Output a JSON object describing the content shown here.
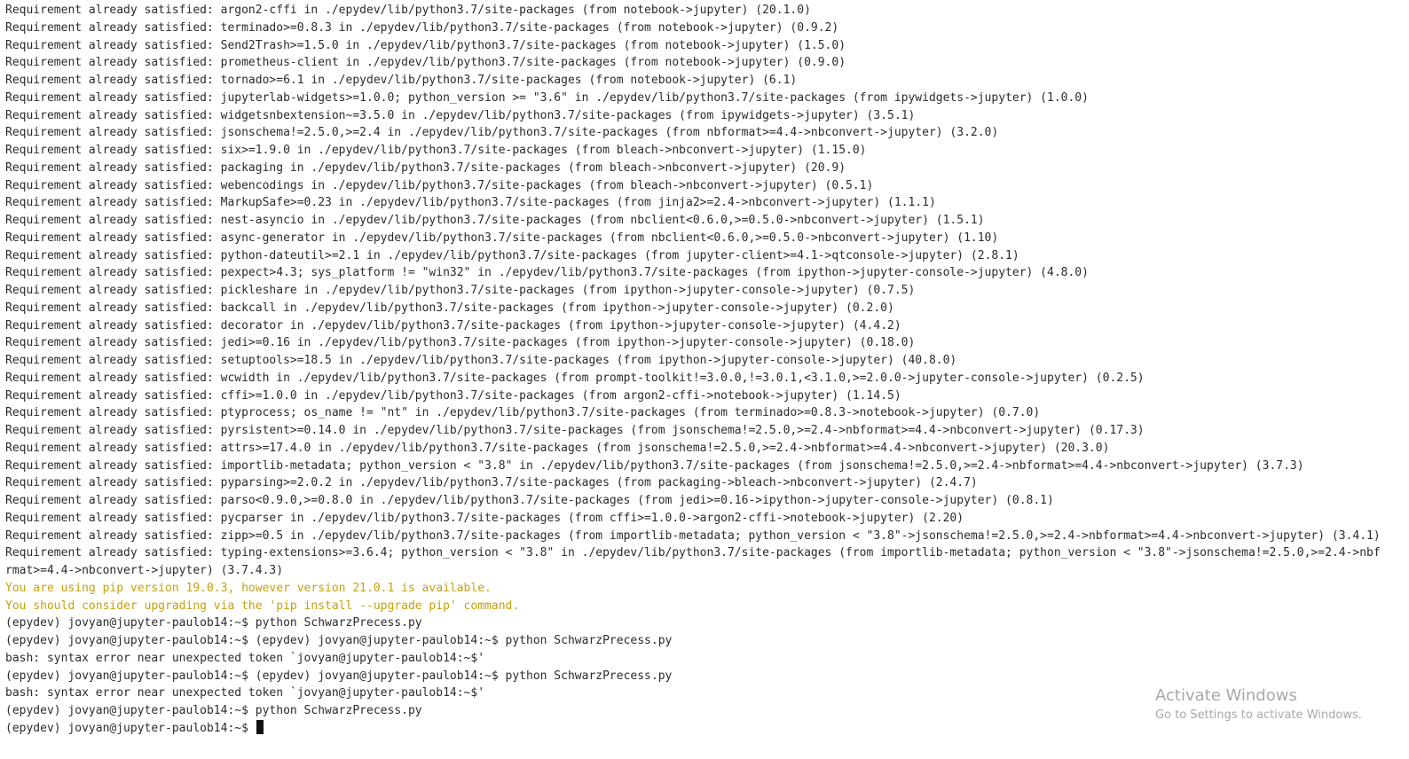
{
  "terminal": {
    "lines": [
      {
        "text": "Requirement already satisfied: argon2-cffi in ./epydev/lib/python3.7/site-packages (from notebook->jupyter) (20.1.0)",
        "kind": "normal"
      },
      {
        "text": "Requirement already satisfied: terminado>=0.8.3 in ./epydev/lib/python3.7/site-packages (from notebook->jupyter) (0.9.2)",
        "kind": "normal"
      },
      {
        "text": "Requirement already satisfied: Send2Trash>=1.5.0 in ./epydev/lib/python3.7/site-packages (from notebook->jupyter) (1.5.0)",
        "kind": "normal"
      },
      {
        "text": "Requirement already satisfied: prometheus-client in ./epydev/lib/python3.7/site-packages (from notebook->jupyter) (0.9.0)",
        "kind": "normal"
      },
      {
        "text": "Requirement already satisfied: tornado>=6.1 in ./epydev/lib/python3.7/site-packages (from notebook->jupyter) (6.1)",
        "kind": "normal"
      },
      {
        "text": "Requirement already satisfied: jupyterlab-widgets>=1.0.0; python_version >= \"3.6\" in ./epydev/lib/python3.7/site-packages (from ipywidgets->jupyter) (1.0.0)",
        "kind": "normal"
      },
      {
        "text": "Requirement already satisfied: widgetsnbextension~=3.5.0 in ./epydev/lib/python3.7/site-packages (from ipywidgets->jupyter) (3.5.1)",
        "kind": "normal"
      },
      {
        "text": "Requirement already satisfied: jsonschema!=2.5.0,>=2.4 in ./epydev/lib/python3.7/site-packages (from nbformat>=4.4->nbconvert->jupyter) (3.2.0)",
        "kind": "normal"
      },
      {
        "text": "Requirement already satisfied: six>=1.9.0 in ./epydev/lib/python3.7/site-packages (from bleach->nbconvert->jupyter) (1.15.0)",
        "kind": "normal"
      },
      {
        "text": "Requirement already satisfied: packaging in ./epydev/lib/python3.7/site-packages (from bleach->nbconvert->jupyter) (20.9)",
        "kind": "normal"
      },
      {
        "text": "Requirement already satisfied: webencodings in ./epydev/lib/python3.7/site-packages (from bleach->nbconvert->jupyter) (0.5.1)",
        "kind": "normal"
      },
      {
        "text": "Requirement already satisfied: MarkupSafe>=0.23 in ./epydev/lib/python3.7/site-packages (from jinja2>=2.4->nbconvert->jupyter) (1.1.1)",
        "kind": "normal"
      },
      {
        "text": "Requirement already satisfied: nest-asyncio in ./epydev/lib/python3.7/site-packages (from nbclient<0.6.0,>=0.5.0->nbconvert->jupyter) (1.5.1)",
        "kind": "normal"
      },
      {
        "text": "Requirement already satisfied: async-generator in ./epydev/lib/python3.7/site-packages (from nbclient<0.6.0,>=0.5.0->nbconvert->jupyter) (1.10)",
        "kind": "normal"
      },
      {
        "text": "Requirement already satisfied: python-dateutil>=2.1 in ./epydev/lib/python3.7/site-packages (from jupyter-client>=4.1->qtconsole->jupyter) (2.8.1)",
        "kind": "normal"
      },
      {
        "text": "Requirement already satisfied: pexpect>4.3; sys_platform != \"win32\" in ./epydev/lib/python3.7/site-packages (from ipython->jupyter-console->jupyter) (4.8.0)",
        "kind": "normal"
      },
      {
        "text": "Requirement already satisfied: pickleshare in ./epydev/lib/python3.7/site-packages (from ipython->jupyter-console->jupyter) (0.7.5)",
        "kind": "normal"
      },
      {
        "text": "Requirement already satisfied: backcall in ./epydev/lib/python3.7/site-packages (from ipython->jupyter-console->jupyter) (0.2.0)",
        "kind": "normal"
      },
      {
        "text": "Requirement already satisfied: decorator in ./epydev/lib/python3.7/site-packages (from ipython->jupyter-console->jupyter) (4.4.2)",
        "kind": "normal"
      },
      {
        "text": "Requirement already satisfied: jedi>=0.16 in ./epydev/lib/python3.7/site-packages (from ipython->jupyter-console->jupyter) (0.18.0)",
        "kind": "normal"
      },
      {
        "text": "Requirement already satisfied: setuptools>=18.5 in ./epydev/lib/python3.7/site-packages (from ipython->jupyter-console->jupyter) (40.8.0)",
        "kind": "normal"
      },
      {
        "text": "Requirement already satisfied: wcwidth in ./epydev/lib/python3.7/site-packages (from prompt-toolkit!=3.0.0,!=3.0.1,<3.1.0,>=2.0.0->jupyter-console->jupyter) (0.2.5)",
        "kind": "normal"
      },
      {
        "text": "Requirement already satisfied: cffi>=1.0.0 in ./epydev/lib/python3.7/site-packages (from argon2-cffi->notebook->jupyter) (1.14.5)",
        "kind": "normal"
      },
      {
        "text": "Requirement already satisfied: ptyprocess; os_name != \"nt\" in ./epydev/lib/python3.7/site-packages (from terminado>=0.8.3->notebook->jupyter) (0.7.0)",
        "kind": "normal"
      },
      {
        "text": "Requirement already satisfied: pyrsistent>=0.14.0 in ./epydev/lib/python3.7/site-packages (from jsonschema!=2.5.0,>=2.4->nbformat>=4.4->nbconvert->jupyter) (0.17.3)",
        "kind": "normal"
      },
      {
        "text": "Requirement already satisfied: attrs>=17.4.0 in ./epydev/lib/python3.7/site-packages (from jsonschema!=2.5.0,>=2.4->nbformat>=4.4->nbconvert->jupyter) (20.3.0)",
        "kind": "normal"
      },
      {
        "text": "Requirement already satisfied: importlib-metadata; python_version < \"3.8\" in ./epydev/lib/python3.7/site-packages (from jsonschema!=2.5.0,>=2.4->nbformat>=4.4->nbconvert->jupyter) (3.7.3)",
        "kind": "normal"
      },
      {
        "text": "Requirement already satisfied: pyparsing>=2.0.2 in ./epydev/lib/python3.7/site-packages (from packaging->bleach->nbconvert->jupyter) (2.4.7)",
        "kind": "normal"
      },
      {
        "text": "Requirement already satisfied: parso<0.9.0,>=0.8.0 in ./epydev/lib/python3.7/site-packages (from jedi>=0.16->ipython->jupyter-console->jupyter) (0.8.1)",
        "kind": "normal"
      },
      {
        "text": "Requirement already satisfied: pycparser in ./epydev/lib/python3.7/site-packages (from cffi>=1.0.0->argon2-cffi->notebook->jupyter) (2.20)",
        "kind": "normal"
      },
      {
        "text": "Requirement already satisfied: zipp>=0.5 in ./epydev/lib/python3.7/site-packages (from importlib-metadata; python_version < \"3.8\"->jsonschema!=2.5.0,>=2.4->nbformat>=4.4->nbconvert->jupyter) (3.4.1)",
        "kind": "normal"
      },
      {
        "text": "Requirement already satisfied: typing-extensions>=3.6.4; python_version < \"3.8\" in ./epydev/lib/python3.7/site-packages (from importlib-metadata; python_version < \"3.8\"->jsonschema!=2.5.0,>=2.4->nbf",
        "kind": "normal"
      },
      {
        "text": "rmat>=4.4->nbconvert->jupyter) (3.7.4.3)",
        "kind": "normal"
      },
      {
        "text": "You are using pip version 19.0.3, however version 21.0.1 is available.",
        "kind": "warn"
      },
      {
        "text": "You should consider upgrading via the 'pip install --upgrade pip' command.",
        "kind": "warn"
      },
      {
        "text": "(epydev) jovyan@jupyter-paulob14:~$ python SchwarzPrecess.py",
        "kind": "normal"
      },
      {
        "text": "(epydev) jovyan@jupyter-paulob14:~$ (epydev) jovyan@jupyter-paulob14:~$ python SchwarzPrecess.py",
        "kind": "normal"
      },
      {
        "text": "bash: syntax error near unexpected token `jovyan@jupyter-paulob14:~$'",
        "kind": "normal"
      },
      {
        "text": "(epydev) jovyan@jupyter-paulob14:~$ (epydev) jovyan@jupyter-paulob14:~$ python SchwarzPrecess.py",
        "kind": "normal"
      },
      {
        "text": "bash: syntax error near unexpected token `jovyan@jupyter-paulob14:~$'",
        "kind": "normal"
      },
      {
        "text": "(epydev) jovyan@jupyter-paulob14:~$ python SchwarzPrecess.py",
        "kind": "normal"
      }
    ],
    "prompt": "(epydev) jovyan@jupyter-paulob14:~$ ",
    "colors": {
      "text": "#2b2b2b",
      "warning": "#c7a008",
      "background": "#ffffff",
      "cursor": "#111111"
    }
  },
  "watermark": {
    "title": "Activate Windows",
    "subtitle": "Go to Settings to activate Windows."
  }
}
